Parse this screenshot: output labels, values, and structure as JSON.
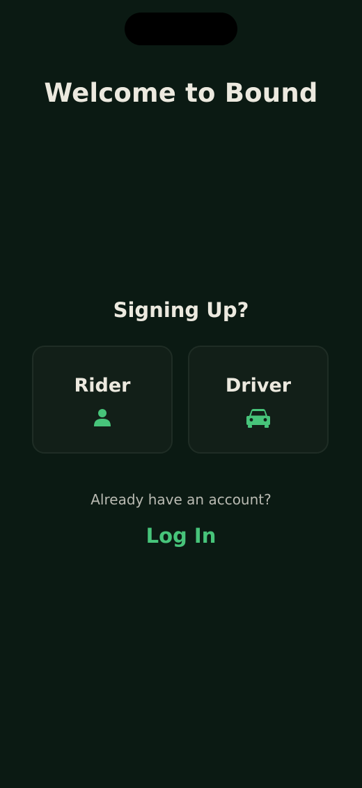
{
  "screen": {
    "title": "Welcome to Bound",
    "signup_prompt": "Signing Up?"
  },
  "roles": [
    {
      "label": "Rider",
      "icon": "person-icon"
    },
    {
      "label": "Driver",
      "icon": "car-icon"
    }
  ],
  "login": {
    "prompt": "Already have an account?",
    "link_label": "Log In"
  },
  "colors": {
    "background": "#0b1a13",
    "card": "#121f18",
    "card_border": "#1f2d25",
    "accent": "#47c47a",
    "text": "#ece9df",
    "muted_text": "#b9bab2"
  }
}
